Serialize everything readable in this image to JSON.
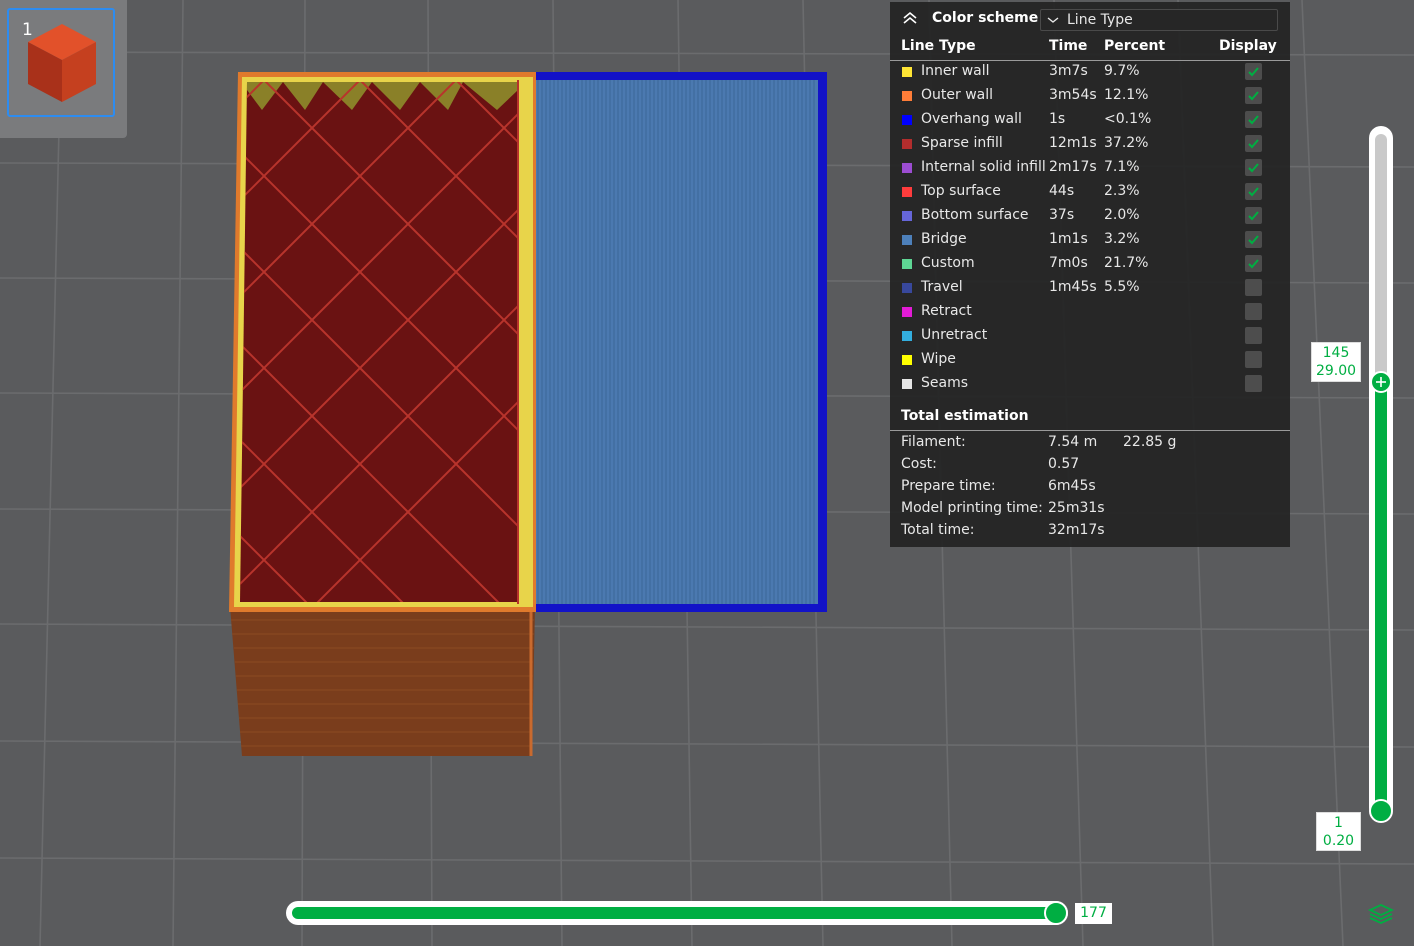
{
  "thumbnail": {
    "index": "1"
  },
  "legend": {
    "header": {
      "title": "Color scheme",
      "scheme_value": "Line Type"
    },
    "columns": {
      "type": "Line Type",
      "time": "Time",
      "percent": "Percent",
      "display": "Display"
    },
    "rows": [
      {
        "name": "Inner wall",
        "time": "3m7s",
        "percent": "9.7%",
        "color": "#ffe535",
        "checked": true
      },
      {
        "name": "Outer wall",
        "time": "3m54s",
        "percent": "12.1%",
        "color": "#ff7d38",
        "checked": true
      },
      {
        "name": "Overhang wall",
        "time": "1s",
        "percent": "<0.1%",
        "color": "#0000ff",
        "checked": true
      },
      {
        "name": "Sparse infill",
        "time": "12m1s",
        "percent": "37.2%",
        "color": "#b22d2d",
        "checked": true
      },
      {
        "name": "Internal solid infill",
        "time": "2m17s",
        "percent": "7.1%",
        "color": "#9c4dd2",
        "checked": true
      },
      {
        "name": "Top surface",
        "time": "44s",
        "percent": "2.3%",
        "color": "#ff3c3c",
        "checked": true
      },
      {
        "name": "Bottom surface",
        "time": "37s",
        "percent": "2.0%",
        "color": "#6666d9",
        "checked": true
      },
      {
        "name": "Bridge",
        "time": "1m1s",
        "percent": "3.2%",
        "color": "#4d80ba",
        "checked": true
      },
      {
        "name": "Custom",
        "time": "7m0s",
        "percent": "21.7%",
        "color": "#5ed694",
        "checked": true
      },
      {
        "name": "Travel",
        "time": "1m45s",
        "percent": "5.5%",
        "color": "#38489c",
        "checked": false
      },
      {
        "name": "Retract",
        "time": "",
        "percent": "",
        "color": "#e21bd6",
        "checked": false
      },
      {
        "name": "Unretract",
        "time": "",
        "percent": "",
        "color": "#33aede",
        "checked": false
      },
      {
        "name": "Wipe",
        "time": "",
        "percent": "",
        "color": "#ffff00",
        "checked": false
      },
      {
        "name": "Seams",
        "time": "",
        "percent": "",
        "color": "#e6e6e6",
        "checked": false
      }
    ],
    "total": {
      "title": "Total estimation",
      "filament_label": "Filament:",
      "filament_length": "7.54 m",
      "filament_weight": "22.85 g",
      "cost_label": "Cost:",
      "cost_value": "0.57",
      "prepare_label": "Prepare time:",
      "prepare_value": "6m45s",
      "model_time_label": "Model printing time:",
      "model_time_value": "25m31s",
      "total_time_label": "Total time:",
      "total_time_value": "32m17s"
    }
  },
  "layer_slider": {
    "top_layer": "145",
    "top_height": "29.00",
    "bottom_layer": "1",
    "bottom_height": "0.20",
    "progress_fraction": 0.819
  },
  "move_slider": {
    "value": "177",
    "progress_fraction": 1.0
  },
  "colors": {
    "accent_green": "#00ae42",
    "selection_blue": "#2d8cf0"
  }
}
